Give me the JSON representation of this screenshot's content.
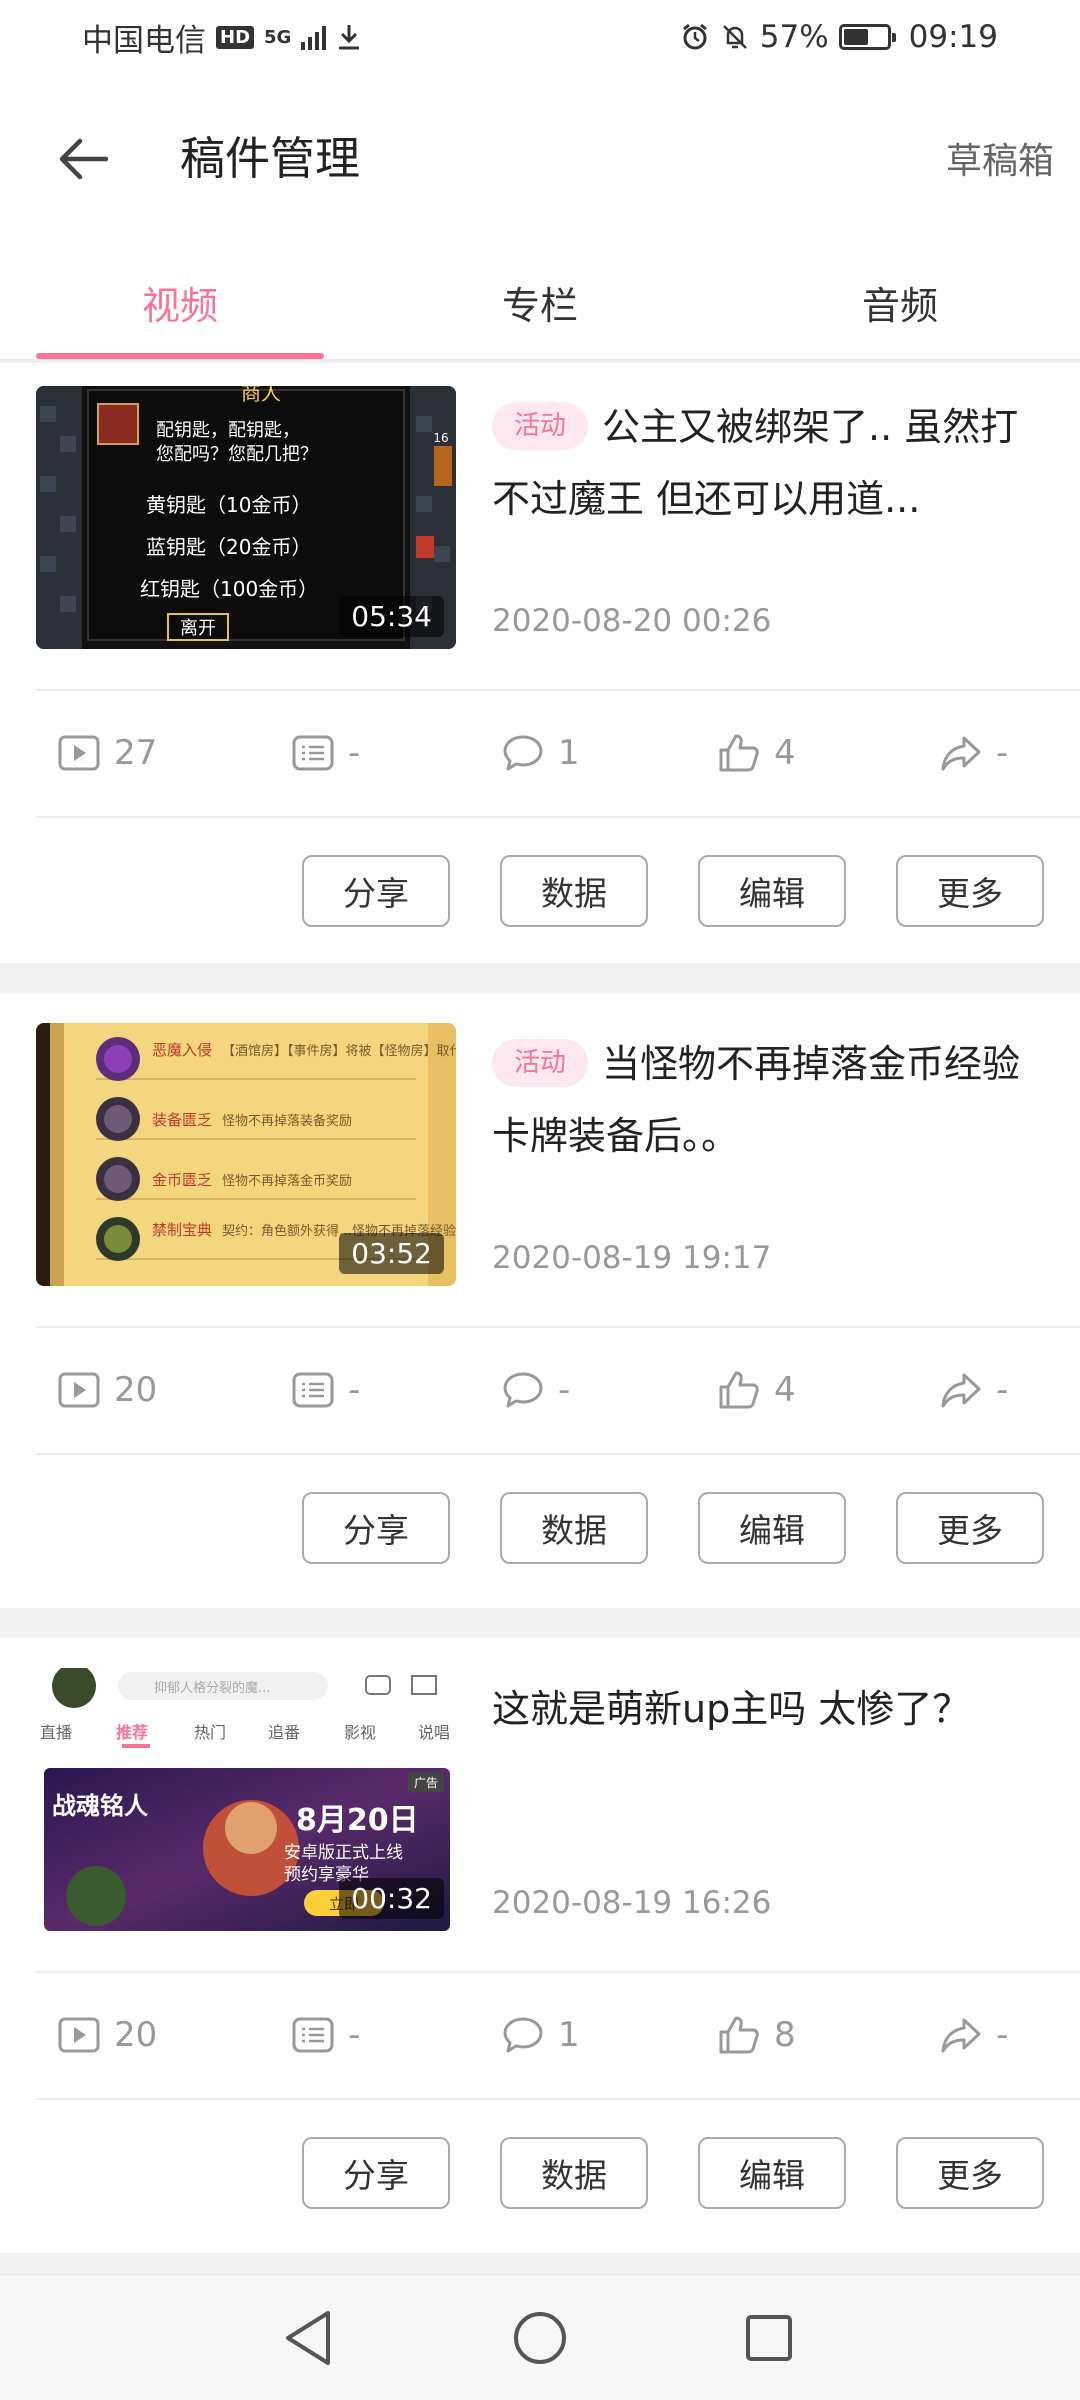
{
  "status_bar": {
    "carrier": "中国电信",
    "hd": "HD",
    "network": "5G",
    "battery": "57%",
    "battery_level": 0.57,
    "time": "09:19"
  },
  "header": {
    "title": "稿件管理",
    "drafts_label": "草稿箱"
  },
  "tabs": [
    {
      "label": "视频",
      "active": true
    },
    {
      "label": "专栏",
      "active": false
    },
    {
      "label": "音频",
      "active": false
    }
  ],
  "videos": [
    {
      "badge": "活动",
      "title": "公主又被绑架了.. 虽然打不过魔王 但还可以用道...",
      "date": "2020-08-20 00:26",
      "duration": "05:34",
      "stats": {
        "plays": "27",
        "danmaku": "-",
        "comments": "1",
        "likes": "4",
        "shares": "-"
      },
      "thumb": {
        "shop_title": "商人",
        "lines": [
          "配钥匙，配钥匙，",
          "您配吗？您配几把？",
          "黄钥匙（10金币）",
          "蓝钥匙（20金币）",
          "红钥匙（100金币）"
        ],
        "leave": "离开",
        "floor": "16"
      }
    },
    {
      "badge": "活动",
      "title": "当怪物不再掉落金币经验卡牌装备后。。",
      "date": "2020-08-19 19:17",
      "duration": "03:52",
      "stats": {
        "plays": "20",
        "danmaku": "-",
        "comments": "-",
        "likes": "4",
        "shares": "-"
      },
      "thumb": {
        "rows": [
          {
            "name": "恶魔入侵",
            "desc": "【酒馆房】【事件房】将被【怪物房】取代"
          },
          {
            "name": "装备匮乏",
            "desc": "怪物不再掉落装备奖励"
          },
          {
            "name": "金币匮乏",
            "desc": "怪物不再掉落金币奖励"
          },
          {
            "name": "禁制宝典",
            "desc": "契约：角色额外获得…怪物不再掉落经验奖励"
          }
        ]
      }
    },
    {
      "badge": "",
      "title": "这就是萌新up主吗 太惨了？",
      "date": "2020-08-19 16:26",
      "duration": "00:32",
      "stats": {
        "plays": "20",
        "danmaku": "-",
        "comments": "1",
        "likes": "8",
        "shares": "-"
      },
      "thumb": {
        "search_placeholder": "抑郁人格分裂的魔...",
        "nav": [
          "直播",
          "推荐",
          "热门",
          "追番",
          "影视",
          "说唱"
        ],
        "ad_label": "广告",
        "game_logo": "战魂铭人",
        "banner_date": "8月20日",
        "banner_line1": "安卓版正式上线",
        "banner_line2": "预约享豪华",
        "banner_cta": "立即"
      }
    }
  ],
  "actions": {
    "share": "分享",
    "data": "数据",
    "edit": "编辑",
    "more": "更多"
  },
  "colors": {
    "accent": "#fb7299",
    "badge_bg": "#fde8ef",
    "muted": "#999999"
  }
}
